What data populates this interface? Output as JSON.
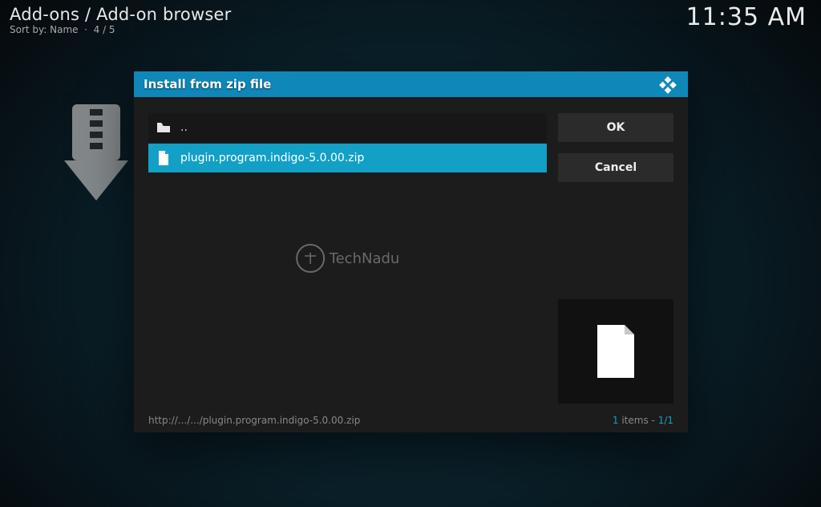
{
  "header": {
    "title": "Add-ons / Add-on browser",
    "sort_label": "Sort by: Name",
    "position": "4 / 5",
    "clock": "11:35 AM"
  },
  "dialog": {
    "title": "Install from zip file",
    "parent_label": "..",
    "items": [
      {
        "name": "plugin.program.indigo-5.0.00.zip",
        "selected": true
      }
    ],
    "ok_label": "OK",
    "cancel_label": "Cancel",
    "path": "http://.../.../plugin.program.indigo-5.0.00.zip",
    "count_prefix": "1",
    "count_word": "items",
    "count_pos": "1/1"
  },
  "watermark": {
    "brand": "TechNadu"
  }
}
